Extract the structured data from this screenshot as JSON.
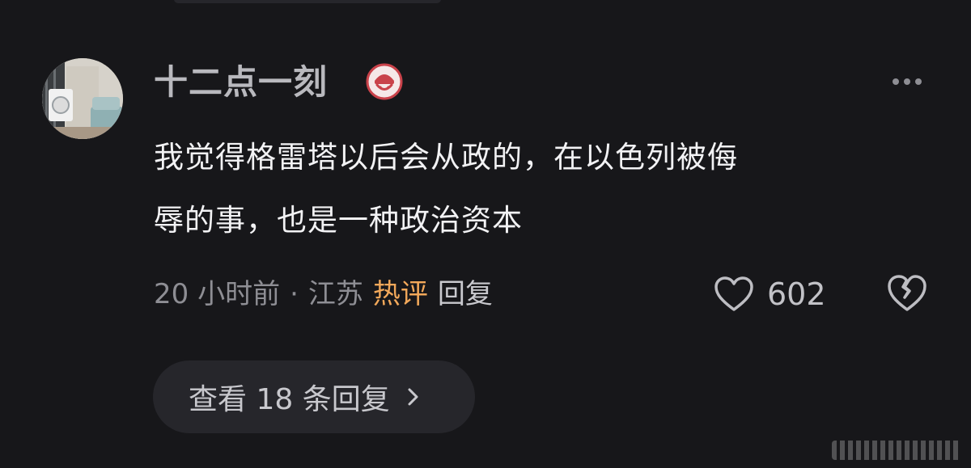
{
  "comment": {
    "username": "十二点一刻",
    "badge_icon": "red-mask-badge-icon",
    "text_lines": [
      "我觉得格雷塔以后会从政的，在以色列被侮",
      "辱的事，也是一种政治资本"
    ],
    "time": "20 小时前",
    "separator": "·",
    "location": "江苏",
    "hot_tag": "热评",
    "reply_label": "回复",
    "likes": "602",
    "view_replies_label": "查看 18 条回复",
    "icons": {
      "more": "more-dots-icon",
      "like": "heart-outline-icon",
      "dislike": "broken-heart-icon",
      "chevron": "chevron-right-icon"
    },
    "colors": {
      "background": "#17171a",
      "username": "#b9b9be",
      "text": "#f2f2f4",
      "meta": "#8e8e94",
      "hot": "#f2a85a",
      "pill": "#26262b"
    }
  }
}
